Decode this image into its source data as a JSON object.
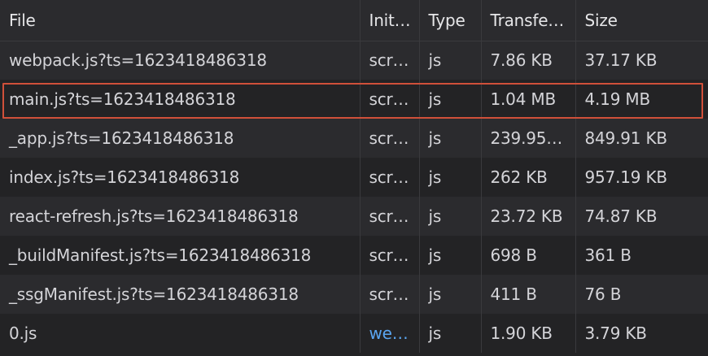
{
  "columns": {
    "file": "File",
    "initiator": "Init…",
    "type": "Type",
    "transferred": "Transfe…",
    "size": "Size"
  },
  "rows": [
    {
      "file": "webpack.js?ts=1623418486318",
      "initiator": "scr…",
      "type": "js",
      "transferred": "7.86 KB",
      "size": "37.17 KB"
    },
    {
      "file": "main.js?ts=1623418486318",
      "initiator": "scr…",
      "type": "js",
      "transferred": "1.04 MB",
      "size": "4.19 MB"
    },
    {
      "file": "_app.js?ts=1623418486318",
      "initiator": "scr…",
      "type": "js",
      "transferred": "239.95…",
      "size": "849.91 KB"
    },
    {
      "file": "index.js?ts=1623418486318",
      "initiator": "scr…",
      "type": "js",
      "transferred": "262 KB",
      "size": "957.19 KB"
    },
    {
      "file": "react-refresh.js?ts=1623418486318",
      "initiator": "scr…",
      "type": "js",
      "transferred": "23.72 KB",
      "size": "74.87 KB"
    },
    {
      "file": "_buildManifest.js?ts=1623418486318",
      "initiator": "scr…",
      "type": "js",
      "transferred": "698 B",
      "size": "361 B"
    },
    {
      "file": "_ssgManifest.js?ts=1623418486318",
      "initiator": "scr…",
      "type": "js",
      "transferred": "411 B",
      "size": "76 B"
    },
    {
      "file": "0.js",
      "initiator": "we…",
      "type": "js",
      "transferred": "1.90 KB",
      "size": "3.79 KB"
    }
  ],
  "colors": {
    "background": "#232325",
    "row_alt": "#2b2b2e",
    "selection_border": "#d0503a",
    "link": "#5aa5f0"
  }
}
